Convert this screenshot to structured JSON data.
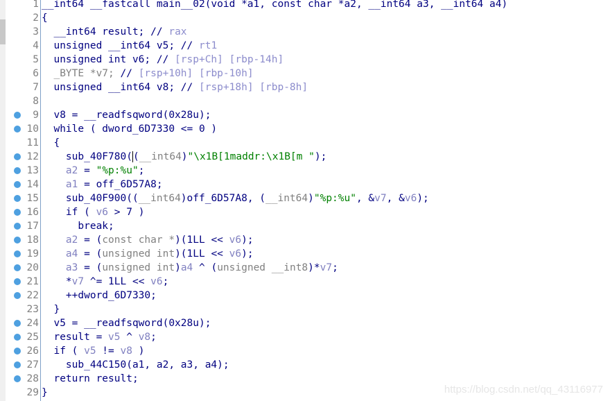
{
  "editor": {
    "breakpoint_color": "#4ea0e0",
    "lines": [
      {
        "n": "1",
        "dot": false,
        "t": [
          [
            "n",
            "__int64 __fastcall main__02(void *a1, const char *a2, __int64 a3, __int64 a4)"
          ]
        ]
      },
      {
        "n": "2",
        "dot": false,
        "t": [
          [
            "n",
            "{"
          ]
        ]
      },
      {
        "n": "3",
        "dot": false,
        "t": [
          [
            "n",
            "  __int64 result; //"
          ],
          [
            "c",
            " rax"
          ]
        ]
      },
      {
        "n": "4",
        "dot": false,
        "t": [
          [
            "n",
            "  unsigned __int64 v5; //"
          ],
          [
            "c",
            " rt1"
          ]
        ]
      },
      {
        "n": "5",
        "dot": false,
        "t": [
          [
            "n",
            "  unsigned int v6; //"
          ],
          [
            "c",
            " [rsp+Ch] [rbp-14h]"
          ]
        ]
      },
      {
        "n": "6",
        "dot": false,
        "t": [
          [
            "g",
            "  _BYTE *v7;"
          ],
          [
            "n",
            " //"
          ],
          [
            "c",
            " [rsp+10h] [rbp-10h]"
          ]
        ]
      },
      {
        "n": "7",
        "dot": false,
        "t": [
          [
            "n",
            "  unsigned __int64 v8; //"
          ],
          [
            "c",
            " [rsp+18h] [rbp-8h]"
          ]
        ]
      },
      {
        "n": "8",
        "dot": false,
        "t": []
      },
      {
        "n": "9",
        "dot": true,
        "t": [
          [
            "n",
            "  v8 = __readfsqword(0x28u);"
          ]
        ]
      },
      {
        "n": "10",
        "dot": true,
        "t": [
          [
            "n",
            "  while ( dword_6D7330 <= 0 )"
          ]
        ]
      },
      {
        "n": "11",
        "dot": false,
        "t": [
          [
            "n",
            "  {"
          ]
        ]
      },
      {
        "n": "12",
        "dot": true,
        "t": [
          [
            "n",
            "    sub_40F780("
          ],
          [
            "caret",
            ""
          ],
          [
            "n",
            "("
          ],
          [
            "g",
            "__int64"
          ],
          [
            "n",
            ")"
          ],
          [
            "s",
            "\"\\x1B[1maddr:\\x1B[m \""
          ],
          [
            "n",
            ");"
          ]
        ]
      },
      {
        "n": "13",
        "dot": true,
        "t": [
          [
            "v",
            "    a2"
          ],
          [
            "n",
            " = "
          ],
          [
            "s",
            "\"%p:%u\""
          ],
          [
            "n",
            ";"
          ]
        ]
      },
      {
        "n": "14",
        "dot": true,
        "t": [
          [
            "v",
            "    a1"
          ],
          [
            "n",
            " = off_6D57A8;"
          ]
        ]
      },
      {
        "n": "15",
        "dot": true,
        "t": [
          [
            "n",
            "    sub_40F900(("
          ],
          [
            "g",
            "__int64"
          ],
          [
            "n",
            ")off_6D57A8, ("
          ],
          [
            "g",
            "__int64"
          ],
          [
            "n",
            ")"
          ],
          [
            "s",
            "\"%p:%u\""
          ],
          [
            "n",
            ", &"
          ],
          [
            "v",
            "v7"
          ],
          [
            "n",
            ", &"
          ],
          [
            "v",
            "v6"
          ],
          [
            "n",
            ");"
          ]
        ]
      },
      {
        "n": "16",
        "dot": true,
        "t": [
          [
            "n",
            "    if ( "
          ],
          [
            "v",
            "v6"
          ],
          [
            "n",
            " > 7 )"
          ]
        ]
      },
      {
        "n": "17",
        "dot": true,
        "t": [
          [
            "n",
            "      break;"
          ]
        ]
      },
      {
        "n": "18",
        "dot": true,
        "t": [
          [
            "v",
            "    a2"
          ],
          [
            "n",
            " = ("
          ],
          [
            "g",
            "const char *"
          ],
          [
            "n",
            ")(1LL << "
          ],
          [
            "v",
            "v6"
          ],
          [
            "n",
            ");"
          ]
        ]
      },
      {
        "n": "19",
        "dot": true,
        "t": [
          [
            "v",
            "    a4"
          ],
          [
            "n",
            " = ("
          ],
          [
            "g",
            "unsigned int"
          ],
          [
            "n",
            ")(1LL << "
          ],
          [
            "v",
            "v6"
          ],
          [
            "n",
            ");"
          ]
        ]
      },
      {
        "n": "20",
        "dot": true,
        "t": [
          [
            "v",
            "    a3"
          ],
          [
            "n",
            " = ("
          ],
          [
            "g",
            "unsigned int"
          ],
          [
            "n",
            ")"
          ],
          [
            "v",
            "a4"
          ],
          [
            "n",
            " ^ ("
          ],
          [
            "g",
            "unsigned __int8"
          ],
          [
            "n",
            ")*"
          ],
          [
            "v",
            "v7"
          ],
          [
            "n",
            ";"
          ]
        ]
      },
      {
        "n": "21",
        "dot": true,
        "t": [
          [
            "n",
            "    *"
          ],
          [
            "v",
            "v7"
          ],
          [
            "n",
            " ^= 1LL << "
          ],
          [
            "v",
            "v6"
          ],
          [
            "n",
            ";"
          ]
        ]
      },
      {
        "n": "22",
        "dot": true,
        "t": [
          [
            "n",
            "    ++dword_6D7330;"
          ]
        ]
      },
      {
        "n": "23",
        "dot": false,
        "t": [
          [
            "n",
            "  }"
          ]
        ]
      },
      {
        "n": "24",
        "dot": true,
        "t": [
          [
            "n",
            "  v5 = __readfsqword(0x28u);"
          ]
        ]
      },
      {
        "n": "25",
        "dot": true,
        "t": [
          [
            "n",
            "  result = "
          ],
          [
            "v",
            "v5"
          ],
          [
            "n",
            " ^ "
          ],
          [
            "v",
            "v8"
          ],
          [
            "n",
            ";"
          ]
        ]
      },
      {
        "n": "26",
        "dot": true,
        "t": [
          [
            "n",
            "  if ( "
          ],
          [
            "v",
            "v5"
          ],
          [
            "n",
            " != "
          ],
          [
            "v",
            "v8"
          ],
          [
            "n",
            " )"
          ]
        ]
      },
      {
        "n": "27",
        "dot": true,
        "t": [
          [
            "n",
            "    sub_44C150(a1, a2, a3, a4);"
          ]
        ]
      },
      {
        "n": "28",
        "dot": true,
        "t": [
          [
            "n",
            "  return result;"
          ]
        ]
      },
      {
        "n": "29",
        "dot": false,
        "t": [
          [
            "n",
            "}"
          ]
        ]
      }
    ]
  },
  "watermark": "https://blog.csdn.net/qq_43116977"
}
